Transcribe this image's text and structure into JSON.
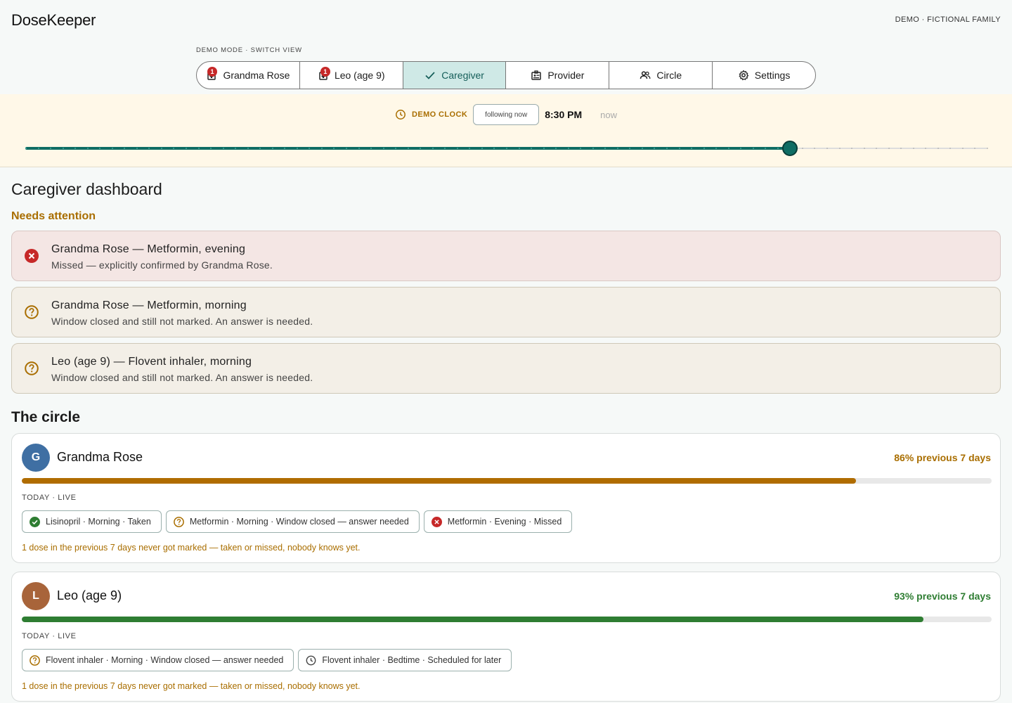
{
  "app": {
    "title": "DoseKeeper",
    "demo_tag": "DEMO · FICTIONAL FAMILY"
  },
  "view_switcher": {
    "label": "DEMO MODE · SWITCH VIEW",
    "tabs": [
      {
        "label": "Grandma Rose",
        "icon": "medication-icon",
        "badge": "1",
        "active": false
      },
      {
        "label": "Leo (age 9)",
        "icon": "medication-icon",
        "badge": "1",
        "active": false
      },
      {
        "label": "Caregiver",
        "icon": "check-icon",
        "badge": "",
        "active": true
      },
      {
        "label": "Provider",
        "icon": "clipboard-icon",
        "badge": "",
        "active": false
      },
      {
        "label": "Circle",
        "icon": "people-icon",
        "badge": "",
        "active": false
      },
      {
        "label": "Settings",
        "icon": "gear-icon",
        "badge": "",
        "active": false
      }
    ]
  },
  "demo_clock": {
    "label": "DEMO CLOCK",
    "following_label": "following now",
    "time": "8:30 PM",
    "now_label": "now",
    "slider_position": 0.795
  },
  "dashboard": {
    "title": "Caregiver dashboard",
    "needs_attention_label": "Needs attention",
    "alerts": [
      {
        "kind": "missed",
        "title": "Grandma Rose — Metformin, evening",
        "subtitle": "Missed — explicitly confirmed by Grandma Rose."
      },
      {
        "kind": "unknown",
        "title": "Grandma Rose — Metformin, morning",
        "subtitle": "Window closed and still not marked. An answer is needed."
      },
      {
        "kind": "unknown",
        "title": "Leo (age 9) — Flovent inhaler, morning",
        "subtitle": "Window closed and still not marked. An answer is needed."
      }
    ]
  },
  "circle": {
    "title": "The circle",
    "members": [
      {
        "initial": "G",
        "name": "Grandma Rose",
        "adherence_label": "86% previous 7 days",
        "adherence": 0.86,
        "today_label": "TODAY · LIVE",
        "doses": [
          {
            "status": "taken",
            "label": "Lisinopril · Morning · Taken"
          },
          {
            "status": "unknown",
            "label": "Metformin · Morning · Window closed — answer needed"
          },
          {
            "status": "missed",
            "label": "Metformin · Evening · Missed"
          }
        ],
        "note": "1 dose in the previous 7 days never got marked — taken or missed, nobody knows yet."
      },
      {
        "initial": "L",
        "name": "Leo (age 9)",
        "adherence_label": "93% previous 7 days",
        "adherence": 0.93,
        "today_label": "TODAY · LIVE",
        "doses": [
          {
            "status": "unknown",
            "label": "Flovent inhaler · Morning · Window closed — answer needed"
          },
          {
            "status": "scheduled",
            "label": "Flovent inhaler · Bedtime · Scheduled for later"
          }
        ],
        "note": "1 dose in the previous 7 days never got marked — taken or missed, nobody knows yet."
      }
    ]
  },
  "colors": {
    "accent": "#0f6d64",
    "warning": "#a96e00",
    "danger": "#c62828",
    "success": "#2e7d32",
    "avatar_grandma": "#3f6fa3",
    "avatar_leo": "#a8643a"
  }
}
